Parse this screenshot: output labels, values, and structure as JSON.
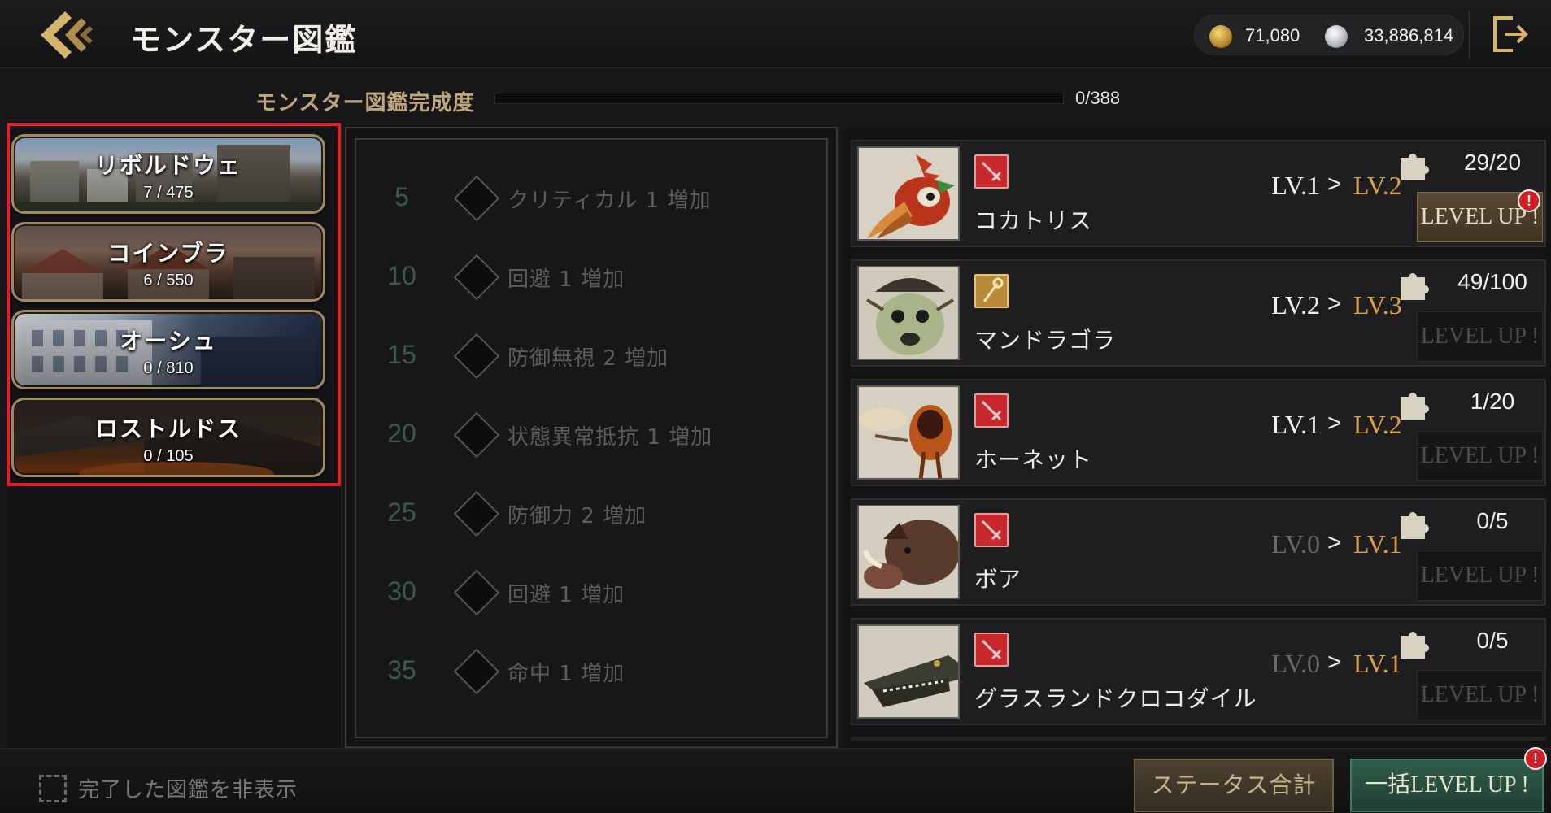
{
  "header": {
    "title": "モンスター図鑑",
    "gold_amount": "71,080",
    "silver_amount": "33,886,814",
    "gold_icon": "gold-coin-icon",
    "silver_icon": "silver-coin-icon"
  },
  "completion": {
    "label": "モンスター図鑑完成度",
    "value": "0/388",
    "progress": 0
  },
  "regions": [
    {
      "name": "リボルドウェ",
      "count": "7 / 475"
    },
    {
      "name": "コインブラ",
      "count": "6 / 550"
    },
    {
      "name": "オーシュ",
      "count": "0 / 810"
    },
    {
      "name": "ロストルドス",
      "count": "0 / 105"
    }
  ],
  "bonuses": [
    {
      "level": "5",
      "text": "クリティカル 1 増加"
    },
    {
      "level": "10",
      "text": "回避 1 増加"
    },
    {
      "level": "15",
      "text": "防御無視 2 増加"
    },
    {
      "level": "20",
      "text": "状態異常抵抗 1 増加"
    },
    {
      "level": "25",
      "text": "防御力 2 増加"
    },
    {
      "level": "30",
      "text": "回避 1 増加"
    },
    {
      "level": "35",
      "text": "命中 1 増加"
    }
  ],
  "monsters": [
    {
      "name": "コカトリス",
      "type": "sword",
      "lv_current": "LV.1",
      "lv_next": "LV.2",
      "pieces": "29/20",
      "button": "LEVEL UP !",
      "can_level_up": true
    },
    {
      "name": "マンドラゴラ",
      "type": "staff",
      "lv_current": "LV.2",
      "lv_next": "LV.3",
      "pieces": "49/100",
      "button": "LEVEL UP !",
      "can_level_up": false
    },
    {
      "name": "ホーネット",
      "type": "sword",
      "lv_current": "LV.1",
      "lv_next": "LV.2",
      "pieces": "1/20",
      "button": "LEVEL UP !",
      "can_level_up": false
    },
    {
      "name": "ボア",
      "type": "sword",
      "lv_current": "LV.0",
      "lv_next": "LV.1",
      "pieces": "0/5",
      "button": "LEVEL UP !",
      "can_level_up": false
    },
    {
      "name": "グラスランドクロコダイル",
      "type": "sword",
      "lv_current": "LV.0",
      "lv_next": "LV.1",
      "pieces": "0/5",
      "button": "LEVEL UP !",
      "can_level_up": false
    }
  ],
  "level_arrow": ">",
  "alert_mark": "!",
  "footer": {
    "hide_completed_label": "完了した図鑑を非表示",
    "status_total_label": "ステータス合計",
    "bulk_level_up_label": "一括LEVEL UP !"
  },
  "colors": {
    "accent_gold": "#c49a45",
    "next_level": "#e0a23c",
    "selection_outline": "#e01f28",
    "alert": "#d41e24"
  }
}
